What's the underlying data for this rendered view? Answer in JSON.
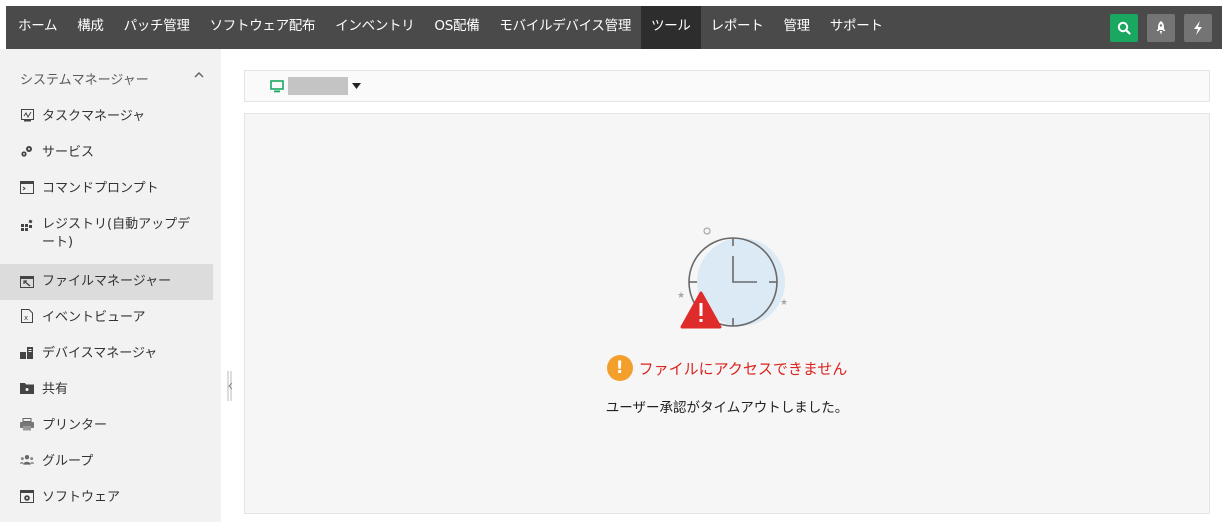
{
  "nav": {
    "items": [
      "ホーム",
      "構成",
      "パッチ管理",
      "ソフトウェア配布",
      "インベントリ",
      "OS配備",
      "モバイルデバイス管理",
      "ツール",
      "レポート",
      "管理",
      "サポート"
    ],
    "active": "ツール"
  },
  "top_icons": [
    "search-icon",
    "rocket-icon",
    "bolt-icon"
  ],
  "sidebar": {
    "header": "システムマネージャー",
    "items": [
      {
        "label": "タスクマネージャ",
        "icon": "task-manager-icon"
      },
      {
        "label": "サービス",
        "icon": "services-icon"
      },
      {
        "label": "コマンドプロンプト",
        "icon": "command-prompt-icon"
      },
      {
        "label": "レジストリ(自動アップデート)",
        "icon": "registry-icon"
      },
      {
        "label": "ファイルマネージャー",
        "icon": "file-manager-icon"
      },
      {
        "label": "イベントビューア",
        "icon": "event-viewer-icon"
      },
      {
        "label": "デバイスマネージャ",
        "icon": "device-manager-icon"
      },
      {
        "label": "共有",
        "icon": "share-icon"
      },
      {
        "label": "プリンター",
        "icon": "printer-icon"
      },
      {
        "label": "グループ",
        "icon": "group-icon"
      },
      {
        "label": "ソフトウェア",
        "icon": "software-icon"
      }
    ],
    "active": "ファイルマネージャー"
  },
  "error": {
    "title": "ファイルにアクセスできません",
    "message": "ユーザー承認がタイムアウトしました。"
  },
  "colors": {
    "accent": "#1aa861",
    "error": "#d9241f",
    "warning": "#f2a02b",
    "topbar": "#4a4a4a"
  }
}
